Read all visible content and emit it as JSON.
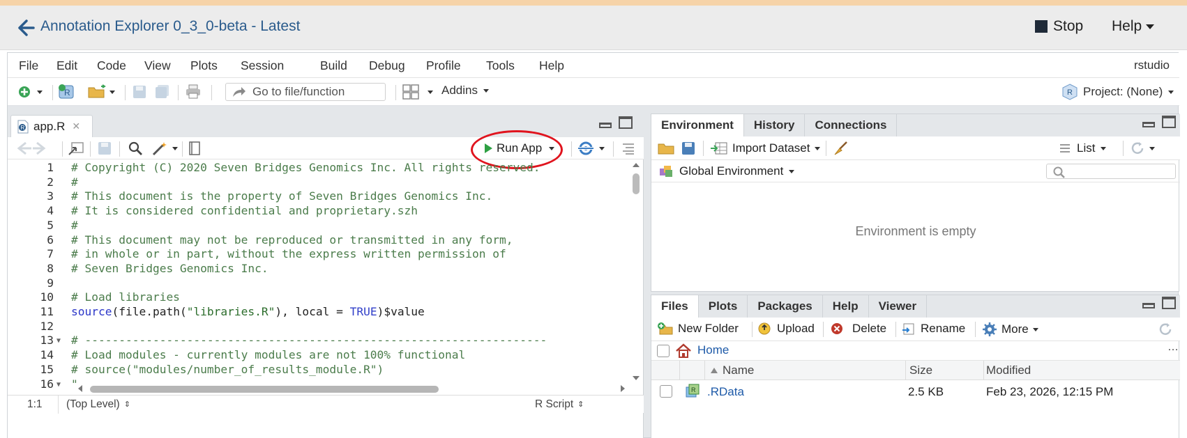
{
  "platform": {
    "title": "Annotation Explorer 0_3_0-beta - Latest",
    "stop_label": "Stop",
    "help_label": "Help"
  },
  "menubar": {
    "items": [
      "File",
      "Edit",
      "Code",
      "View",
      "Plots",
      "Session",
      "Build",
      "Debug",
      "Profile",
      "Tools",
      "Help"
    ],
    "user": "rstudio"
  },
  "toolbar": {
    "goto_placeholder": "Go to file/function",
    "addins_label": "Addins",
    "project_label": "Project: (None)"
  },
  "editor": {
    "tab_label": "app.R",
    "run_app_label": "Run App",
    "lines": [
      {
        "n": "1",
        "text": "# Copyright (C) 2020 Seven Bridges Genomics Inc. All rights reserved."
      },
      {
        "n": "2",
        "text": "#"
      },
      {
        "n": "3",
        "text": "# This document is the property of Seven Bridges Genomics Inc."
      },
      {
        "n": "4",
        "text": "# It is considered confidential and proprietary.szh"
      },
      {
        "n": "5",
        "text": "#"
      },
      {
        "n": "6",
        "text": "# This document may not be reproduced or transmitted in any form,"
      },
      {
        "n": "7",
        "text": "# in whole or in part, without the express written permission of"
      },
      {
        "n": "8",
        "text": "# Seven Bridges Genomics Inc."
      },
      {
        "n": "9",
        "text": ""
      },
      {
        "n": "10",
        "text": "# Load libraries"
      },
      {
        "n": "11",
        "text": "source(file.path(\"libraries.R\"), local = TRUE)$value"
      },
      {
        "n": "12",
        "text": ""
      },
      {
        "n": "13",
        "text": "# --------------------------------------------------------------------"
      },
      {
        "n": "14",
        "text": "# Load modules - currently modules are not 100% functional"
      },
      {
        "n": "15",
        "text": "# source(\"modules/number_of_results_module.R\")"
      },
      {
        "n": "16",
        "text": "\""
      }
    ],
    "line11_parts": {
      "fn": "source",
      "p1": "(file.path(",
      "str": "\"libraries.R\"",
      "p2": "), local = ",
      "kw": "TRUE",
      "p3": ")$value"
    },
    "status_position": "1:1",
    "status_scope": "(Top Level)",
    "status_type": "R Script"
  },
  "env_pane": {
    "tabs": [
      "Environment",
      "History",
      "Connections"
    ],
    "import_label": "Import Dataset",
    "list_label": "List",
    "global_env_label": "Global Environment",
    "empty_text": "Environment is empty"
  },
  "files_pane": {
    "tabs": [
      "Files",
      "Plots",
      "Packages",
      "Help",
      "Viewer"
    ],
    "new_folder_label": "New Folder",
    "upload_label": "Upload",
    "delete_label": "Delete",
    "rename_label": "Rename",
    "more_label": "More",
    "home_label": "Home",
    "col_name": "Name",
    "col_size": "Size",
    "col_modified": "Modified",
    "rows": [
      {
        "name": ".RData",
        "size": "2.5 KB",
        "modified": "Feb 23, 2026, 12:15 PM"
      }
    ]
  },
  "colors": {
    "accent_blue": "#2a5b8c",
    "annotation_red": "#e0141e",
    "comment_green": "#4b7c4b",
    "run_green": "#2ea043"
  }
}
